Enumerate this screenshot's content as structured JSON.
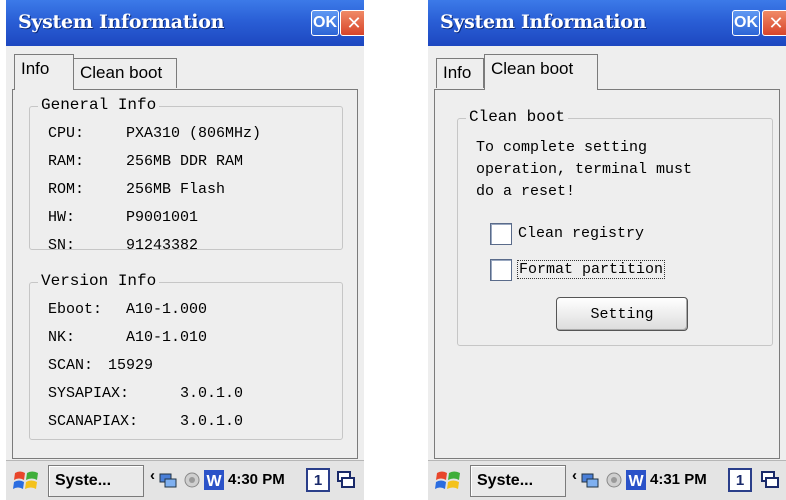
{
  "screens": [
    {
      "title": "System Information",
      "ok_label": "OK",
      "tabs": [
        "Info",
        "Clean boot"
      ],
      "general": {
        "legend": "General Info",
        "rows": [
          {
            "label": "CPU:",
            "value": "PXA310 (806MHz)"
          },
          {
            "label": "RAM:",
            "value": "256MB DDR RAM"
          },
          {
            "label": "ROM:",
            "value": "256MB Flash"
          },
          {
            "label": "HW:",
            "value": "P9001001"
          },
          {
            "label": "SN:",
            "value": "91243382"
          }
        ]
      },
      "version": {
        "legend": "Version Info",
        "rows": [
          {
            "label": "Eboot:",
            "value": "A10-1.000"
          },
          {
            "label": "NK:",
            "value": "A10-1.010"
          },
          {
            "label": "SCAN:",
            "value": "15929"
          },
          {
            "label": "SYSAPIAX:",
            "value": "3.0.1.0"
          },
          {
            "label": "SCANAPIAX:",
            "value": "3.0.1.0"
          }
        ]
      },
      "taskbar": {
        "task_label": "Syste...",
        "clock": "4:30 PM",
        "desk_number": "1"
      }
    },
    {
      "title": "System Information",
      "ok_label": "OK",
      "tabs": [
        "Info",
        "Clean boot"
      ],
      "cleanboot": {
        "legend": "Clean boot",
        "message_lines": [
          "To complete setting",
          "operation, terminal must",
          "do a reset!"
        ],
        "options": [
          {
            "label": "Clean registry",
            "checked": false
          },
          {
            "label": "Format partition",
            "checked": false
          }
        ],
        "button_label": "Setting"
      },
      "taskbar": {
        "task_label": "Syste...",
        "clock": "4:31 PM",
        "desk_number": "1"
      }
    }
  ],
  "icons": {
    "start": "windows-start-icon",
    "network": "network-icon",
    "battery": "battery-icon",
    "input": "input-panel-w-icon",
    "desktop": "desktop-icon"
  },
  "colors": {
    "titlebar": "#2a5fd6",
    "close": "#d7452b",
    "background": "#eeeeee"
  }
}
